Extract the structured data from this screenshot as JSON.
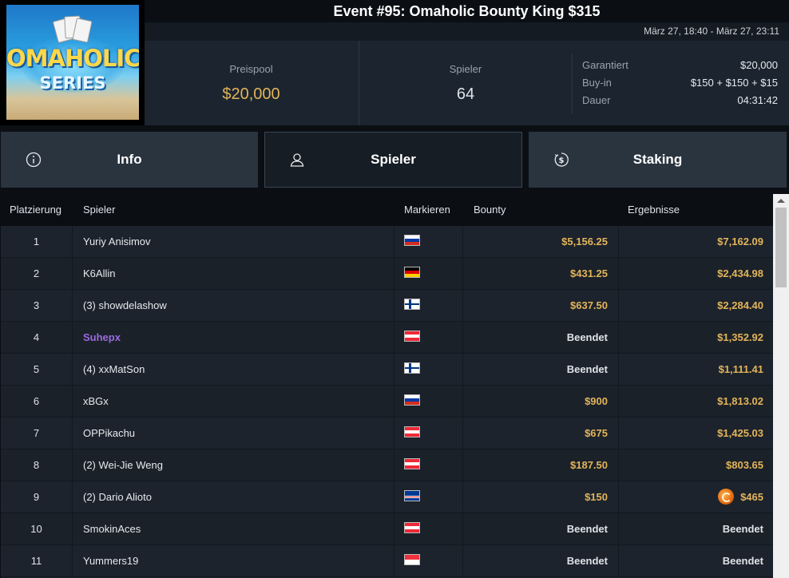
{
  "event": {
    "title": "Event #95: Omaholic Bounty King $315",
    "dates": "März 27, 18:40 - März 27, 23:11",
    "logo_line1": "OMAHOLIC",
    "logo_line2": "SERIES"
  },
  "stats": {
    "prize_label": "Preispool",
    "prize_value": "$20,000",
    "players_label": "Spieler",
    "players_value": "64",
    "details": [
      {
        "label": "Garantiert",
        "value": "$20,000"
      },
      {
        "label": "Buy-in",
        "value": "$150 + $150 + $15"
      },
      {
        "label": "Dauer",
        "value": "04:31:42"
      }
    ]
  },
  "tabs": [
    {
      "label": "Info",
      "icon": "info-icon"
    },
    {
      "label": "Spieler",
      "icon": "user-icon"
    },
    {
      "label": "Staking",
      "icon": "coin-icon"
    }
  ],
  "table": {
    "headers": {
      "place": "Platzierung",
      "player": "Spieler",
      "mark": "Markieren",
      "bounty": "Bounty",
      "result": "Ergebnisse"
    },
    "rows": [
      {
        "place": "1",
        "player": "Yuriy Anisimov",
        "flag": "ru",
        "bounty": "$5,156.25",
        "result": "$7,162.09"
      },
      {
        "place": "2",
        "player": "K6Allin",
        "flag": "de",
        "bounty": "$431.25",
        "result": "$2,434.98"
      },
      {
        "place": "3",
        "player": "(3) showdelashow",
        "flag": "fi",
        "bounty": "$637.50",
        "result": "$2,284.40"
      },
      {
        "place": "4",
        "player": "Suhepx",
        "flag": "at",
        "bounty": "Beendet",
        "result": "$1,352.92",
        "highlight": true
      },
      {
        "place": "5",
        "player": "(4) xxMatSon",
        "flag": "fi",
        "bounty": "Beendet",
        "result": "$1,111.41"
      },
      {
        "place": "6",
        "player": "xBGx",
        "flag": "ru",
        "bounty": "$900",
        "result": "$1,813.02"
      },
      {
        "place": "7",
        "player": "OPPikachu",
        "flag": "at",
        "bounty": "$675",
        "result": "$1,425.03"
      },
      {
        "place": "8",
        "player": "(2) Wei-Jie Weng",
        "flag": "at",
        "bounty": "$187.50",
        "result": "$803.65"
      },
      {
        "place": "9",
        "player": "(2) Dario Alioto",
        "flag": "cv",
        "bounty": "$150",
        "result": "$465",
        "coin": true
      },
      {
        "place": "10",
        "player": "SmokinAces",
        "flag": "at",
        "bounty": "Beendet",
        "result": "Beendet"
      },
      {
        "place": "11",
        "player": "Yummers19",
        "flag": "sg",
        "bounty": "Beendet",
        "result": "Beendet"
      }
    ]
  },
  "colors": {
    "accent": "#e3b45a",
    "highlight_player": "#9b6ae0"
  }
}
